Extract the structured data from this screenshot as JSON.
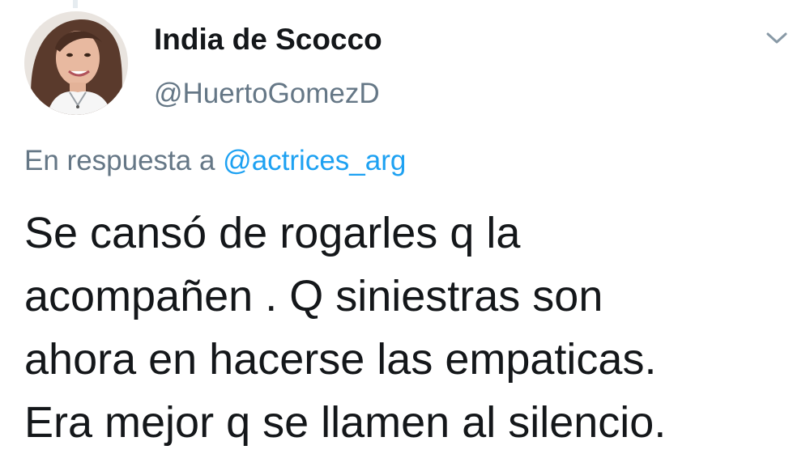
{
  "tweet": {
    "author": {
      "display_name": "India de Scocco",
      "handle": "@HuertoGomezD",
      "avatar_icon": "profile-photo"
    },
    "menu_icon": "chevron-down-icon",
    "reply": {
      "prefix": "En respuesta a",
      "mention": "@actrices_arg"
    },
    "text_lines": [
      "Se cansó de rogarles q la",
      "acompañen . Q siniestras son",
      "ahora en hacerse las empaticas.",
      "Era mejor q se llamen al silencio."
    ]
  },
  "colors": {
    "text_primary": "#14171a",
    "text_secondary": "#657786",
    "link": "#1da1f2"
  }
}
